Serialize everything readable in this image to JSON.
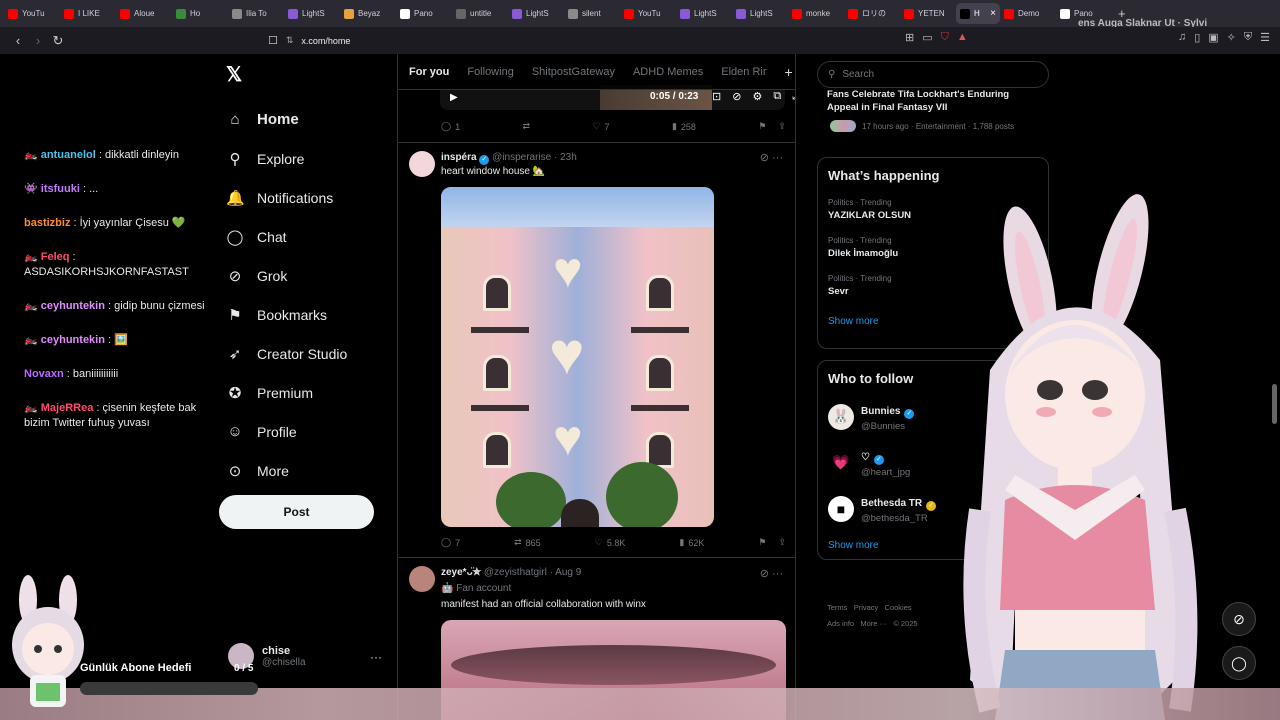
{
  "browser": {
    "tabs": [
      {
        "label": "YouTu",
        "color": "#ff0000",
        "active": false
      },
      {
        "label": "I LIKE",
        "color": "#ff0000",
        "active": false
      },
      {
        "label": "Aloue",
        "color": "#ff0000",
        "active": false
      },
      {
        "label": "Ho",
        "color": "#3b8a3e",
        "active": false
      },
      {
        "label": "Ilia To",
        "color": "#8a8a8a",
        "active": false
      },
      {
        "label": "LightS",
        "color": "#8a5ad6",
        "active": false
      },
      {
        "label": "Beyaz",
        "color": "#e6a23c",
        "active": false
      },
      {
        "label": "Pano",
        "color": "#ffffff",
        "active": false
      },
      {
        "label": "untitle",
        "color": "#666666",
        "active": false
      },
      {
        "label": "LightS",
        "color": "#8a5ad6",
        "active": false
      },
      {
        "label": "silent",
        "color": "#8a8a8a",
        "active": false
      },
      {
        "label": "YouTu",
        "color": "#ff0000",
        "active": false
      },
      {
        "label": "LightS",
        "color": "#8a5ad6",
        "active": false
      },
      {
        "label": "LightS",
        "color": "#8a5ad6",
        "active": false
      },
      {
        "label": "monke",
        "color": "#ff0000",
        "active": false
      },
      {
        "label": "ロリの",
        "color": "#ff0000",
        "active": false
      },
      {
        "label": "YETEN",
        "color": "#ff0000",
        "active": false
      },
      {
        "label": "H",
        "color": "#000000",
        "active": true
      },
      {
        "label": "Demo",
        "color": "#ff0000",
        "active": false
      },
      {
        "label": "Pano",
        "color": "#ffffff",
        "active": false
      }
    ],
    "url": "x.com/home",
    "overlay_text": "ens Auga Slaknar Ut · Sylvi"
  },
  "chat": [
    {
      "user": "antuanelol",
      "color": "#4fc1e9",
      "badge": "🏍️",
      "text": "dikkatli dinleyin"
    },
    {
      "user": "itsfuuki",
      "color": "#c47cff",
      "badge": "👾",
      "text": "..."
    },
    {
      "user": "bastizbiz",
      "color": "#ff8c2a",
      "badge": "",
      "text": "İyi yayınlar Çisesu 💚"
    },
    {
      "user": "Feleq",
      "color": "#ff4d6d",
      "badge": "🏍️",
      "text": "ASDASIKORHSJKORNFASTAST"
    },
    {
      "user": "ceyhuntekin",
      "color": "#e08cff",
      "badge": "🏍️",
      "text": "gidip bunu çizmesi"
    },
    {
      "user": "ceyhuntekin",
      "color": "#e08cff",
      "badge": "🏍️",
      "text": "🖼️"
    },
    {
      "user": "Novaxn",
      "color": "#b96bff",
      "badge": "",
      "text": "baniiiiiiiiiii"
    },
    {
      "user": "MajeRRea",
      "color": "#ff4d6d",
      "badge": "🏍️",
      "text": "çisenin keşfete bak bizim Twitter fuhuş yuvası"
    }
  ],
  "x": {
    "nav": [
      {
        "label": "Home",
        "icon": "home-icon",
        "glyph": "⌂"
      },
      {
        "label": "Explore",
        "icon": "search-icon",
        "glyph": "⚲"
      },
      {
        "label": "Notifications",
        "icon": "bell-icon",
        "glyph": "🔔"
      },
      {
        "label": "Chat",
        "icon": "chat-icon",
        "glyph": "◯"
      },
      {
        "label": "Grok",
        "icon": "grok-icon",
        "glyph": "⊘"
      },
      {
        "label": "Bookmarks",
        "icon": "bookmark-icon",
        "glyph": "⚑"
      },
      {
        "label": "Creator Studio",
        "icon": "rocket-icon",
        "glyph": "➶"
      },
      {
        "label": "Premium",
        "icon": "verified-icon",
        "glyph": "✪"
      },
      {
        "label": "Profile",
        "icon": "person-icon",
        "glyph": "☺"
      },
      {
        "label": "More",
        "icon": "more-circle-icon",
        "glyph": "⊙"
      }
    ],
    "post_label": "Post",
    "account": {
      "name": "chise",
      "handle": "@chisella"
    },
    "feed_tabs": [
      "For you",
      "Following",
      "ShitpostGateway",
      "ADHD Memes",
      "Elden Rir"
    ],
    "video_time": "0:05 / 0:23",
    "tweet0_actions": {
      "replies": "1",
      "reposts": "",
      "likes": "7",
      "views": "258"
    },
    "tweet1": {
      "name": "inspéra",
      "handle": "@insperarise",
      "time": "23h",
      "text": "heart window house 🏡",
      "replies": "7",
      "reposts": "865",
      "likes": "5.8K",
      "views": "62K"
    },
    "tweet2": {
      "name": "zeye*ᴗ̈✮",
      "handle": "@zeyisthatgirl",
      "time": "Aug 9",
      "label": "Fan account",
      "text": "manifest had an official collaboration with winx"
    },
    "search_placeholder": "Search",
    "news": {
      "title": "Fans Celebrate Tifa Lockhart's Enduring Appeal in Final Fantasy VII",
      "meta": "17 hours ago · Entertainment · 1,788 posts"
    },
    "happening": {
      "title": "What’s happening",
      "trends": [
        {
          "meta": "Politics · Trending",
          "name": "YAZIKLAR OLSUN"
        },
        {
          "meta": "Politics · Trending",
          "name": "Dilek İmamoğlu"
        },
        {
          "meta": "Politics · Trending",
          "name": "Sevr"
        }
      ],
      "show_more": "Show more"
    },
    "who_to_follow": {
      "title": "Who to follow",
      "accounts": [
        {
          "name": "Bunnies",
          "handle": "@Bunnies"
        },
        {
          "name": "♡",
          "handle": "@heart_jpg"
        },
        {
          "name": "Bethesda TR",
          "handle": "@bethesda_TR"
        }
      ],
      "show_more": "Show more"
    },
    "footer": {
      "terms": "Terms",
      "privacy": "Privacy",
      "cookies": "Cookies",
      "ads": "Ads info",
      "more": "More ···",
      "copy": "© 2025"
    }
  },
  "stream": {
    "goal_label": "Günlük Abone Hedefi",
    "goal_count": "0 / 5",
    "goal_progress": 0
  }
}
